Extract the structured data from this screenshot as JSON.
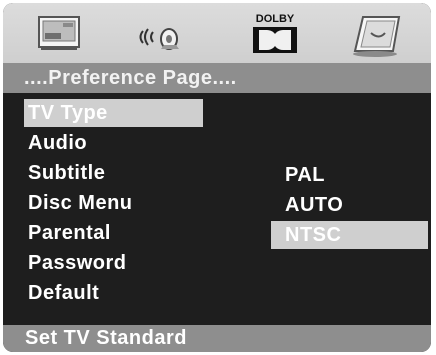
{
  "icon_bar": {
    "tabs": [
      {
        "icon": "tv-icon"
      },
      {
        "icon": "speaker-audio-icon"
      },
      {
        "icon": "dolby-icon",
        "label": "DOLBY"
      },
      {
        "icon": "preference-monitor-icon"
      }
    ]
  },
  "page_title": "....Preference Page....",
  "menu": {
    "items": [
      "TV Type",
      "Audio",
      "Subtitle",
      "Disc Menu",
      "Parental",
      "Password",
      "Default"
    ],
    "selected": "TV Type"
  },
  "options": {
    "items": [
      "PAL",
      "AUTO",
      "NTSC"
    ],
    "selected": "NTSC"
  },
  "status_text": "Set TV Standard",
  "colors": {
    "background": "#1e1e1e",
    "bar": "#8e8e8e",
    "highlight": "#cfcfcf",
    "icon_bar": "#d6d6d6",
    "text": "#ffffff"
  }
}
